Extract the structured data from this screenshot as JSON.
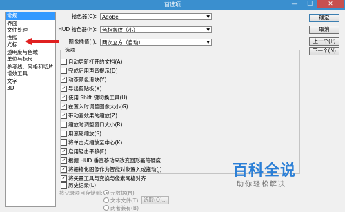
{
  "window": {
    "title": "首选项",
    "minimize": "—",
    "maximize": "☐",
    "close": "✕"
  },
  "sidebar": {
    "items": [
      {
        "label": "常规",
        "selected": true
      },
      {
        "label": "界面"
      },
      {
        "label": "文件处理"
      },
      {
        "label": "性能"
      },
      {
        "label": "光标"
      },
      {
        "label": "透明度与色域"
      },
      {
        "label": "单位与标尺"
      },
      {
        "label": "参考线、网格和切片"
      },
      {
        "label": "增效工具"
      },
      {
        "label": "文字"
      },
      {
        "label": "3D"
      }
    ]
  },
  "fields": {
    "color_picker": {
      "label": "拾色器(C):",
      "value": "Adobe"
    },
    "hud_picker": {
      "label": "HUD 拾色器(H):",
      "value": "色相条纹（小）"
    },
    "interpolation": {
      "label": "图像插值(I):",
      "value": "两次立方（自动）"
    }
  },
  "buttons": {
    "ok": "确定",
    "cancel": "取消",
    "prev": "上一个(P)",
    "next": "下一个(N)"
  },
  "options": {
    "title": "选项",
    "items": [
      {
        "label": "自动更新打开的文档(A)",
        "checked": false
      },
      {
        "label": "完成后用声音提示(D)",
        "checked": false
      },
      {
        "label": "动态颜色滑块(Y)",
        "checked": true
      },
      {
        "label": "导出剪贴板(X)",
        "checked": true
      },
      {
        "label": "使用 Shift 键切换工具(U)",
        "checked": true
      },
      {
        "label": "在置入时调整图像大小(G)",
        "checked": true
      },
      {
        "label": "带动画效果的缩放(Z)",
        "checked": true
      },
      {
        "label": "缩放时调整窗口大小(R)",
        "checked": false
      },
      {
        "label": "用滚轮缩放(S)",
        "checked": false
      },
      {
        "label": "将单击点缩放至中心(K)",
        "checked": false
      },
      {
        "label": "启用轻击平移(F)",
        "checked": true
      },
      {
        "label": "根据 HUD 垂直移动来改变圆形画笔硬度",
        "checked": true
      },
      {
        "label": "将栅格化图像作为智能对象置入或拖动(J)",
        "checked": true
      },
      {
        "label": "将矢量工具与变换与像素网格对齐",
        "checked": true
      }
    ]
  },
  "history": {
    "label": "历史记录(L)",
    "save_to_label": "将记录项目存储到:",
    "metadata": "元数据(M)",
    "text_file": "文本文件(T)",
    "choose_button": "选取(O)...",
    "both": "两者兼有(B)"
  },
  "watermark": {
    "title": "百科全说",
    "subtitle": "助你轻松解决"
  },
  "colors": {
    "titlebar": "#3a8fcf",
    "selection": "#3399ff",
    "arrow": "#e02020",
    "watermark": "#2b7fd6"
  }
}
